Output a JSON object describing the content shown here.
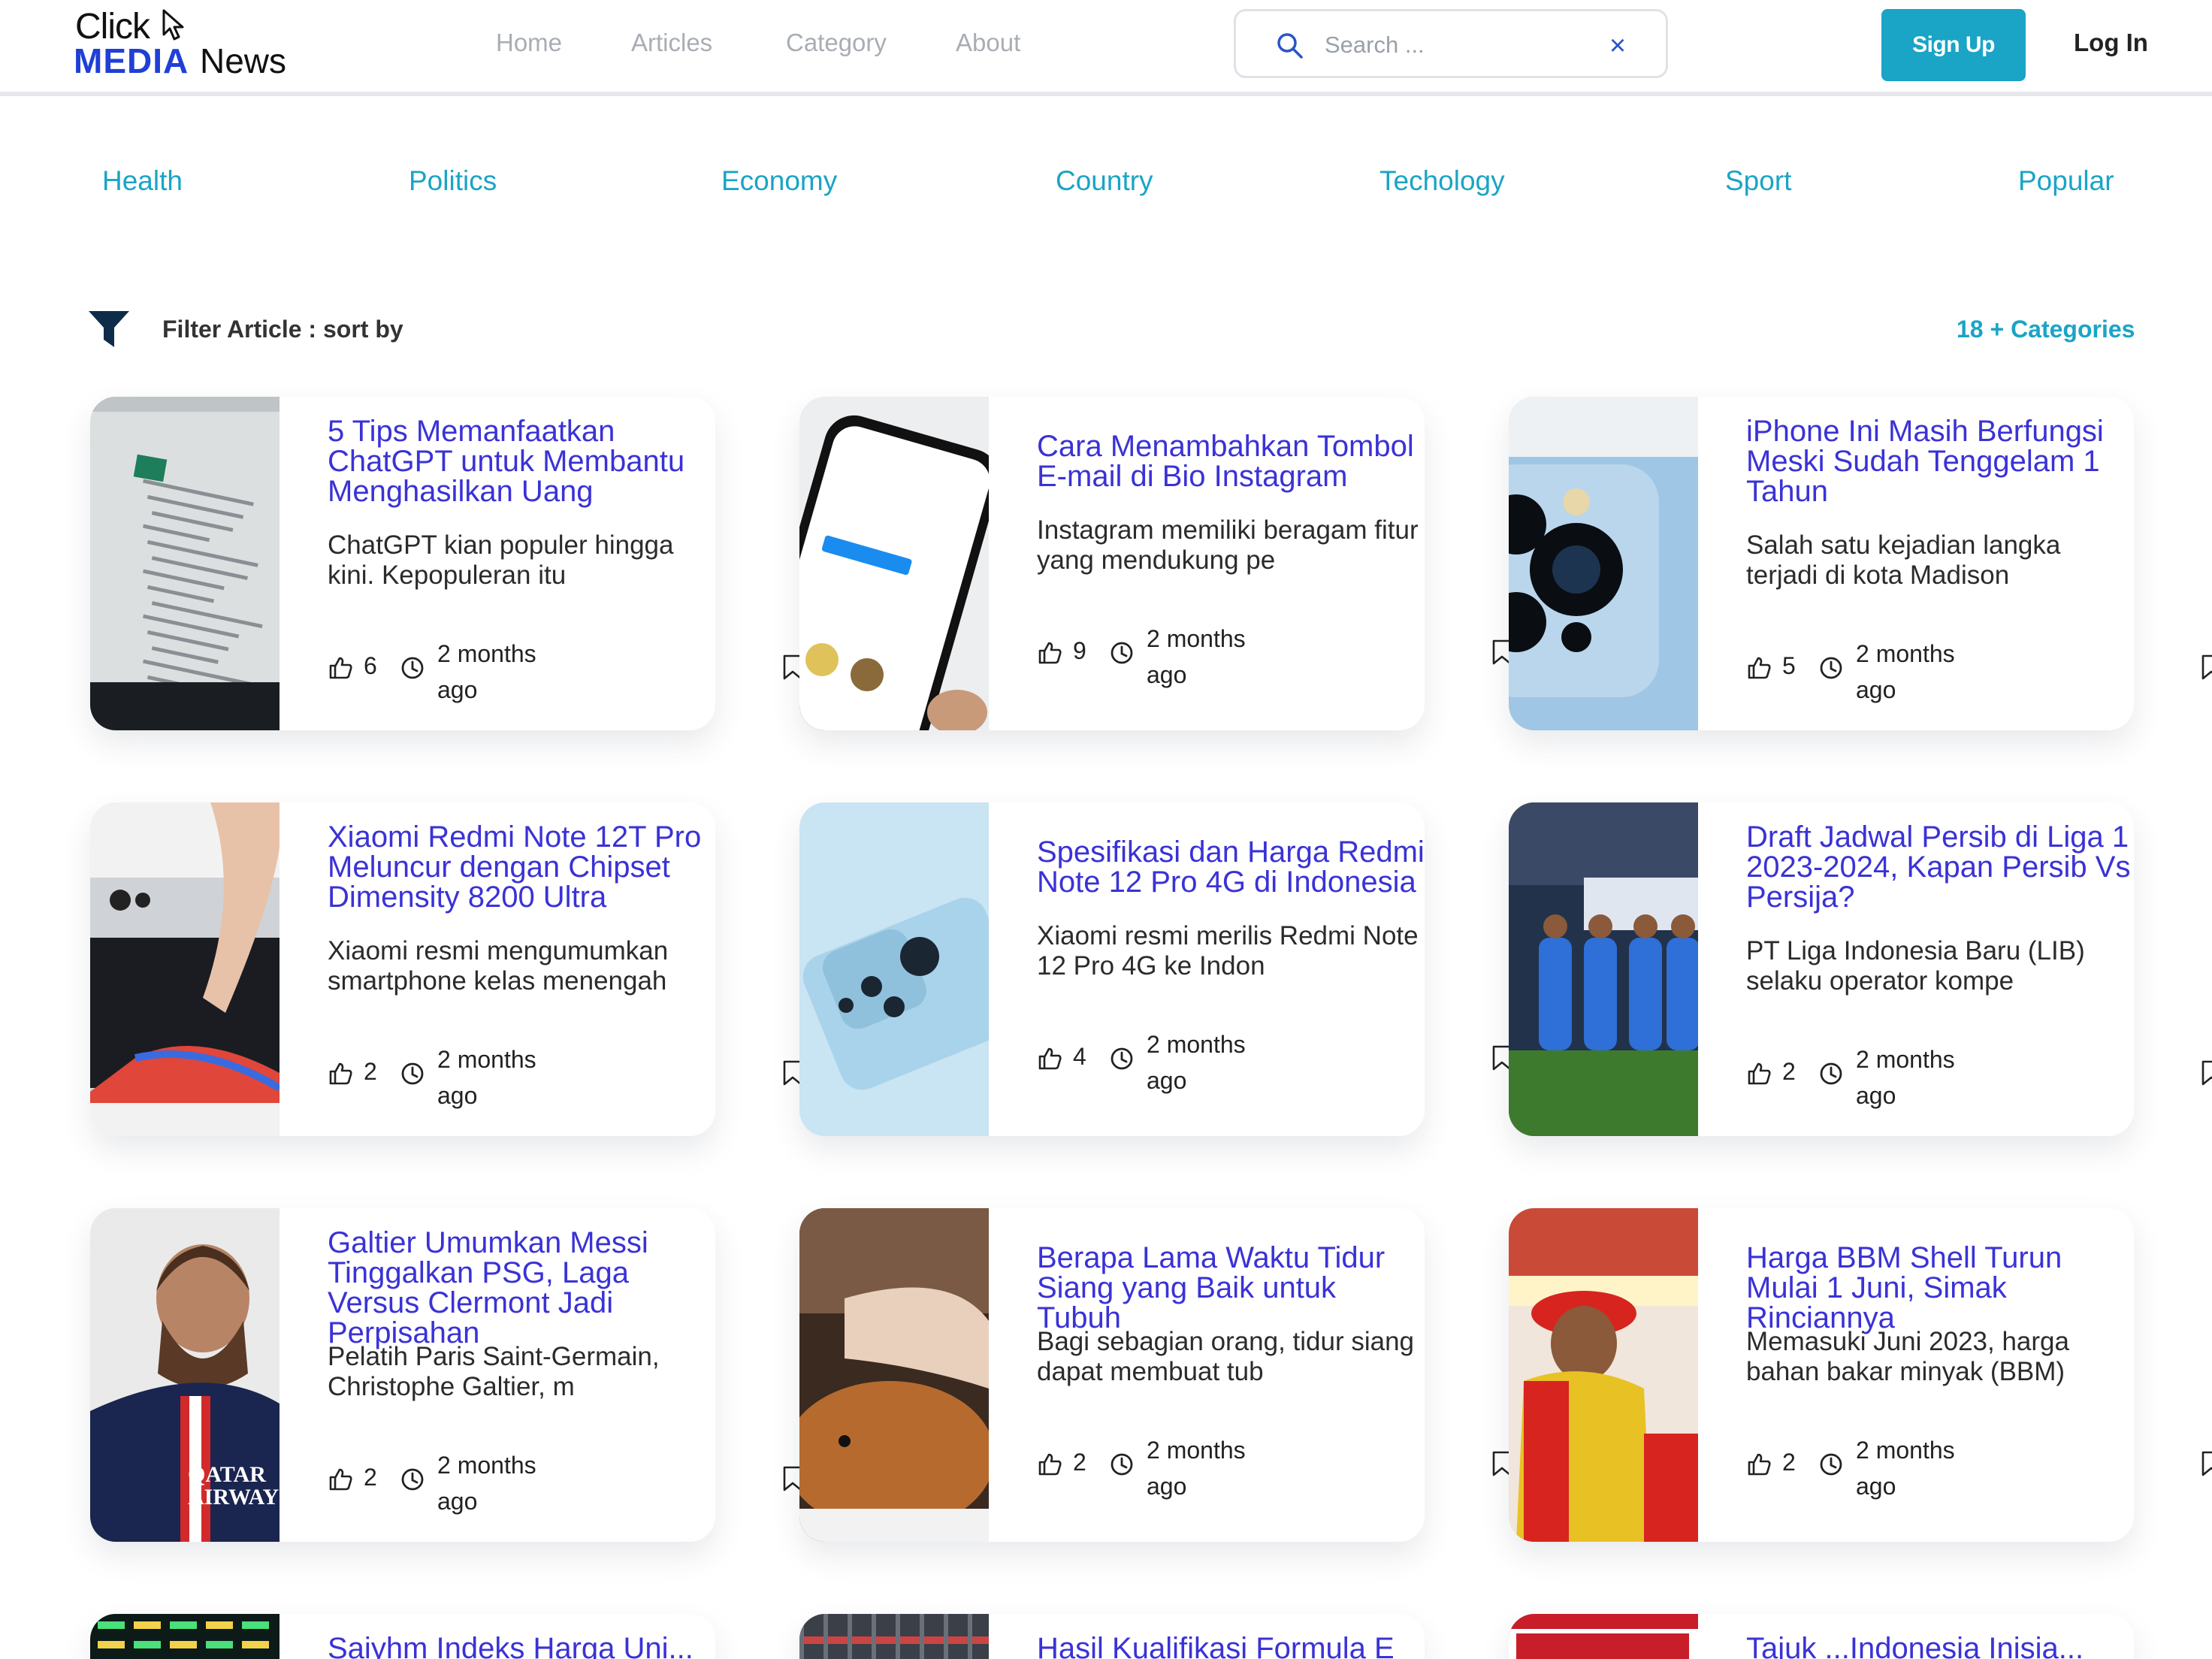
{
  "header": {
    "logo": {
      "click": "Click",
      "media": "MEDIA",
      "news": "News"
    },
    "nav": [
      "Home",
      "Articles",
      "Category",
      "About"
    ],
    "search_placeholder": "Search ...",
    "signup_label": "Sign Up",
    "login_label": "Log In"
  },
  "categories": [
    "Health",
    "Politics",
    "Economy",
    "Country",
    "Techology",
    "Sport",
    "Popular"
  ],
  "filter": {
    "label": "Filter Article : sort by",
    "count_label": "18 + Categories"
  },
  "articles": [
    {
      "title": "5 Tips Memanfaatkan ChatGPT untuk Membantu Menghasilkan Uang",
      "excerpt": "ChatGPT kian populer hingga kini. Kepopuleran itu",
      "likes": "6",
      "time": "2 months ago",
      "image": "chatgpt-screen-photo"
    },
    {
      "title": "Cara Menambahkan Tombol E-mail di Bio Instagram",
      "excerpt": "Instagram memiliki beragam fitur yang mendukung pe",
      "likes": "9",
      "time": "2 months ago",
      "image": "instagram-phone-photo"
    },
    {
      "title": "iPhone Ini Masih Berfungsi Meski Sudah Tenggelam 1 Tahun",
      "excerpt": "Salah satu kejadian langka terjadi di kota Madison",
      "likes": "5",
      "time": "2 months ago",
      "image": "iphone-camera-photo"
    },
    {
      "title": "Xiaomi Redmi Note 12T Pro Meluncur dengan Chipset Dimensity 8200 Ultra",
      "excerpt": "Xiaomi resmi mengumumkan smartphone kelas menengah",
      "likes": "2",
      "time": "2 months ago",
      "image": "redmi-note-12t-photo"
    },
    {
      "title": "Spesifikasi dan Harga Redmi Note 12 Pro 4G di Indonesia",
      "excerpt": "Xiaomi resmi merilis Redmi Note 12 Pro 4G ke Indon",
      "likes": "4",
      "time": "2 months ago",
      "image": "redmi-note-12-pro-photo"
    },
    {
      "title": "Draft Jadwal Persib di Liga 1 2023-2024, Kapan Persib Vs Persija?",
      "excerpt": "PT Liga Indonesia Baru (LIB) selaku operator kompe",
      "likes": "2",
      "time": "2 months ago",
      "image": "persib-players-photo"
    },
    {
      "title": "Galtier Umumkan Messi Tinggalkan PSG, Laga Versus Clermont Jadi Perpisahan",
      "excerpt": "Pelatih Paris Saint-Germain, Christophe Galtier, m",
      "likes": "2",
      "time": "2 months ago",
      "image": "messi-psg-photo",
      "image_text": "QATAR AIRWAYS"
    },
    {
      "title": "Berapa Lama Waktu Tidur Siang yang Baik untuk Tubuh",
      "excerpt": "Bagi sebagian orang, tidur siang dapat membuat tub",
      "likes": "2",
      "time": "2 months ago",
      "image": "sleeping-with-dog-photo"
    },
    {
      "title": "Harga BBM Shell Turun Mulai 1 Juni, Simak Rinciannya",
      "excerpt": "Memasuki Juni 2023, harga bahan bakar minyak (BBM)",
      "likes": "2",
      "time": "2 months ago",
      "image": "shell-attendant-photo"
    }
  ],
  "partial_articles": [
    {
      "title": "Saiyhm Indeks Harga Uni...",
      "image": "stock-board-photo"
    },
    {
      "title": "Hasil Kualifikasi Formula E",
      "image": "formula-e-photo"
    },
    {
      "title": "Tajuk ...Indonesia Inisia...",
      "image": "indonesia-banner-photo"
    }
  ],
  "colors": {
    "brand_blue": "#1f3fd6",
    "accent_cyan": "#1aa4c6",
    "title_purple": "#3a32d6",
    "nav_gray": "#a9adb4"
  }
}
